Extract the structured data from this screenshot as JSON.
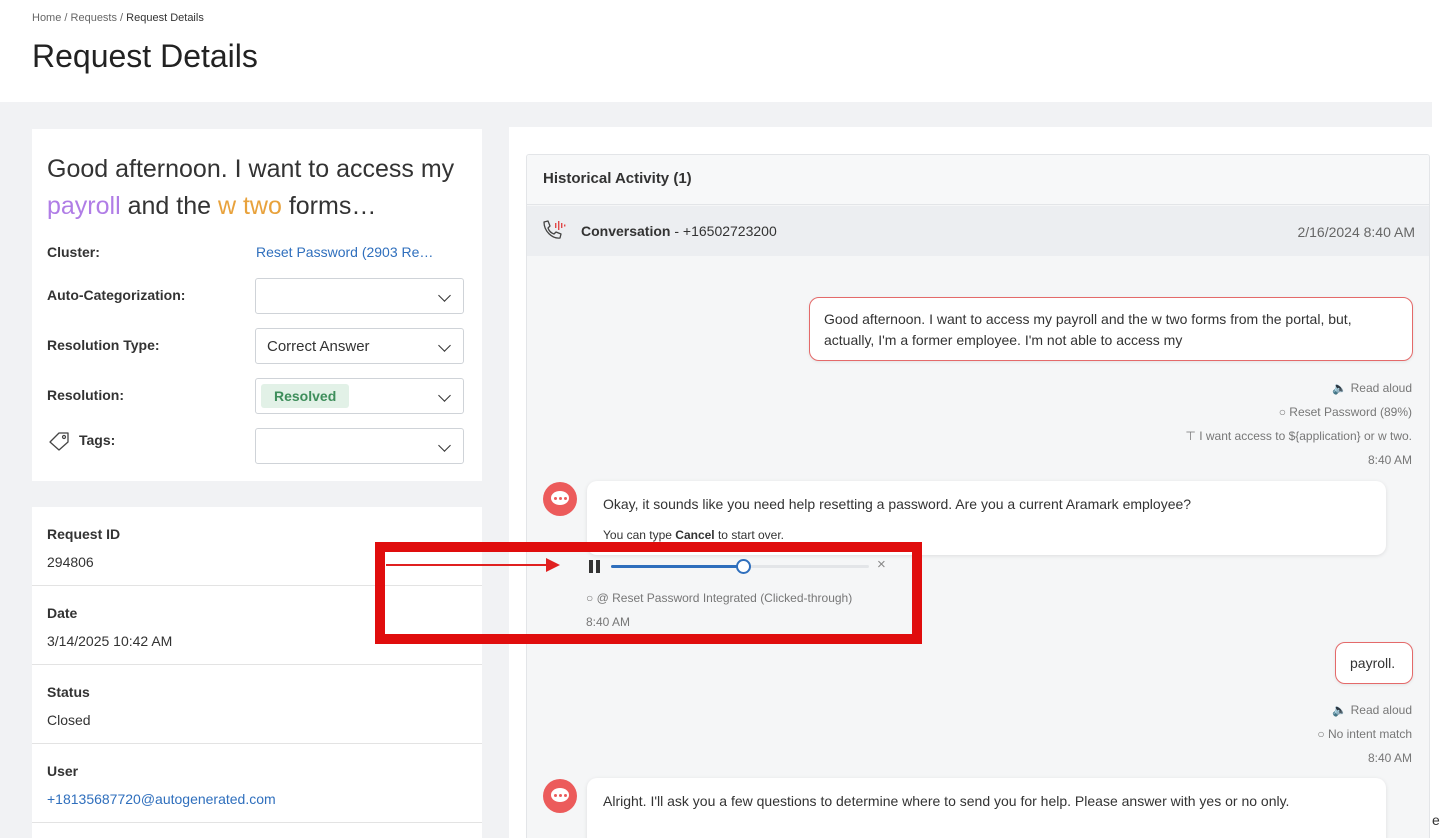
{
  "breadcrumb": {
    "home": "Home",
    "requests": "Requests",
    "current": "Request Details",
    "sep": " / "
  },
  "page_title": "Request Details",
  "request_summary": {
    "title_part1": "Good afternoon. I want to access my ",
    "title_word1": "payroll",
    "title_part2": " and the ",
    "title_word2": "w two",
    "title_part3": " forms…",
    "cluster_label": "Cluster:",
    "cluster_value": "Reset Password (2903 Re…",
    "auto_cat_label": "Auto-Categorization:",
    "auto_cat_value": "",
    "resolution_type_label": "Resolution Type:",
    "resolution_type_value": "Correct Answer",
    "resolution_label": "Resolution:",
    "resolution_value": "Resolved",
    "tags_label": "Tags:",
    "tags_value": ""
  },
  "details": [
    {
      "label": "Request ID",
      "value": "294806"
    },
    {
      "label": "Date",
      "value": "3/14/2025 10:42 AM"
    },
    {
      "label": "Status",
      "value": "Closed"
    },
    {
      "label": "User",
      "value": "+18135687720@autogenerated.com"
    }
  ],
  "history": {
    "title": "Historical Activity (1)",
    "conversation_label": "Conversation",
    "conversation_phone": " - +16502723200",
    "conversation_date": "2/16/2024 8:40 AM",
    "messages": {
      "m1_text": "Good afternoon. I want to access my payroll and the w two forms from the portal, but, actually, I'm a former employee. I'm not able to access my",
      "m1_read_aloud": "Read aloud",
      "m1_intent": "Reset Password (89%)",
      "m1_phrase": "I want access to ${application} or w two.",
      "m1_time": "8:40 AM",
      "m2_text": "Okay, it sounds like you need help resetting a password. Are you a current Aramark employee?",
      "m2_hint_pre": "You can type ",
      "m2_hint_bold": "Cancel",
      "m2_hint_post": " to start over.",
      "m2_flow": "@ Reset Password Integrated (Clicked-through)",
      "m2_time": "8:40 AM",
      "m3_text": "payroll.",
      "m3_read_aloud": "Read aloud",
      "m3_intent": "No intent match",
      "m3_time": "8:40 AM",
      "m4_text": "Alright. I'll ask you a few questions to determine where to send you for help. Please answer with yes or no only."
    },
    "audio_progress": 0.51,
    "audio_close": "×"
  },
  "edge_char": "e",
  "colors": {
    "accent": "#2f6fbd",
    "highlight": "#e00d0d",
    "bot": "#ec5b5b",
    "resolved_bg": "#e2f1e7",
    "resolved_fg": "#3e8e5b"
  }
}
